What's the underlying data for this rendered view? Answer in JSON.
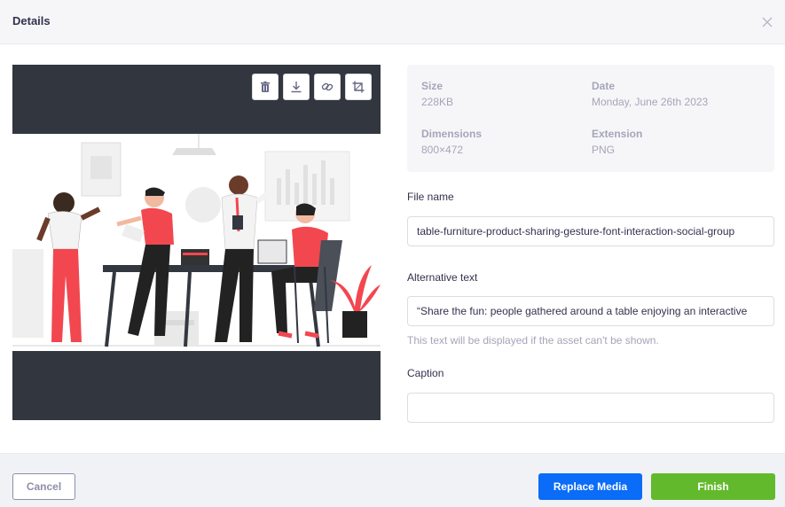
{
  "header": {
    "title": "Details"
  },
  "toolbar": {
    "icons": [
      "trash-icon",
      "download-icon",
      "link-icon",
      "crop-icon"
    ]
  },
  "meta": {
    "size_label": "Size",
    "size_value": "228KB",
    "date_label": "Date",
    "date_value": "Monday, June 26th 2023",
    "dimensions_label": "Dimensions",
    "dimensions_value": "800×472",
    "extension_label": "Extension",
    "extension_value": "PNG"
  },
  "fields": {
    "file_name_label": "File name",
    "file_name_value": "table-furniture-product-sharing-gesture-font-interaction-social-group",
    "alt_label": "Alternative text",
    "alt_value": "“Share the fun: people gathered around a table enjoying an interactive",
    "alt_hint": "This text will be displayed if the asset can't be shown.",
    "caption_label": "Caption",
    "caption_value": ""
  },
  "footer": {
    "cancel": "Cancel",
    "replace": "Replace Media",
    "finish": "Finish"
  },
  "colors": {
    "accent": "#0a6cf7",
    "finish": "#63b92c",
    "illustration_accent": "#f2474f"
  }
}
